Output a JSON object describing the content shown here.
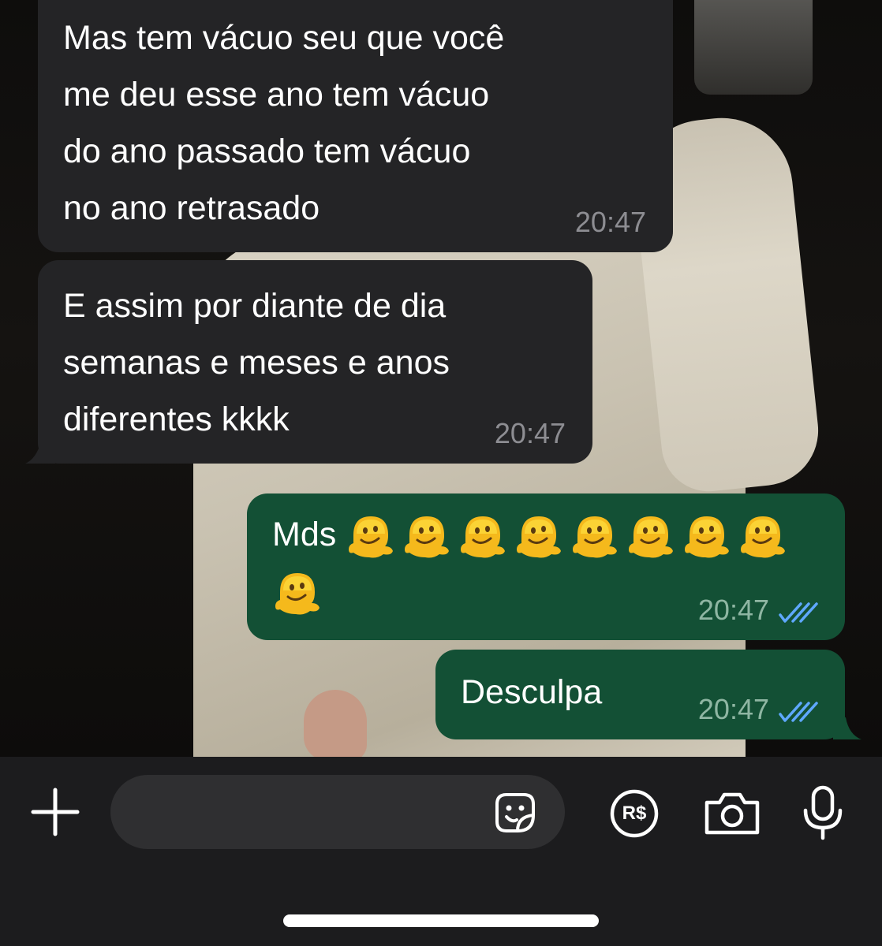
{
  "chat": {
    "messages": [
      {
        "direction": "incoming",
        "text": "Mas tem vácuo seu que você\nme deu esse ano tem vácuo\ndo ano passado tem vácuo\nno ano retrasado",
        "time": "20:47"
      },
      {
        "direction": "incoming",
        "text": "E assim por diante de dia\nsemanas e meses e anos\ndiferentes kkkk",
        "time": "20:47"
      },
      {
        "direction": "outgoing",
        "text": "Mds",
        "emoji": "melting-face",
        "emoji_count": 9,
        "time": "20:47",
        "status": "read",
        "status_icon": "double-check-icon"
      },
      {
        "direction": "outgoing",
        "text": "Desculpa",
        "time": "20:47",
        "status": "read",
        "status_icon": "double-check-icon"
      }
    ]
  },
  "composer": {
    "placeholder": "",
    "icons": [
      "plus-icon",
      "sticker-icon",
      "pix-payment-icon",
      "camera-icon",
      "microphone-icon"
    ],
    "pix_label": "R$"
  },
  "colors": {
    "incoming_bubble": "#242426",
    "outgoing_bubble": "#135035",
    "read_ticks": "#5fa8ff",
    "bar_background": "#1c1c1e"
  }
}
